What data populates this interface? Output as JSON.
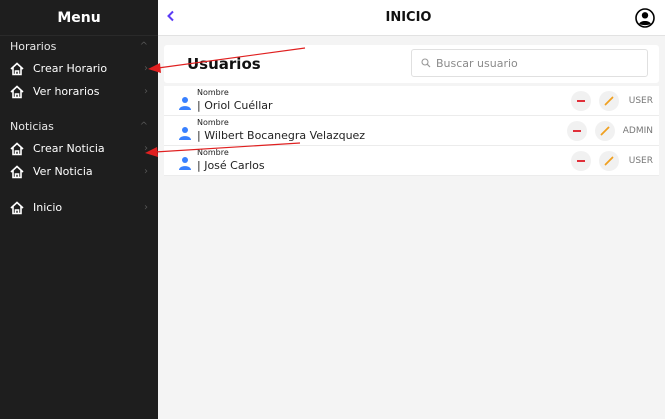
{
  "sidebar": {
    "title": "Menu",
    "sections": [
      {
        "label": "Horarios",
        "items": [
          {
            "label": "Crear Horario"
          },
          {
            "label": "Ver horarios"
          }
        ]
      },
      {
        "label": "Noticias",
        "items": [
          {
            "label": "Crear Noticia"
          },
          {
            "label": "Ver Noticia"
          }
        ]
      }
    ],
    "home": {
      "label": "Inicio"
    }
  },
  "header": {
    "title": "INICIO"
  },
  "users": {
    "title": "Usuarios",
    "search_placeholder": "Buscar usuario",
    "field_label": "Nombre",
    "rows": [
      {
        "name": "| Oriol Cuéllar",
        "role": "USER"
      },
      {
        "name": "| Wilbert Bocanegra Velazquez",
        "role": "ADMIN"
      },
      {
        "name": "| José Carlos",
        "role": "USER"
      }
    ]
  },
  "colors": {
    "sidebar_bg": "#1e1e1e",
    "accent": "#5b3cf5",
    "delete": "#e0303a",
    "edit": "#f0a020",
    "user_icon": "#3880ff",
    "annotation_arrow": "#e02020"
  }
}
